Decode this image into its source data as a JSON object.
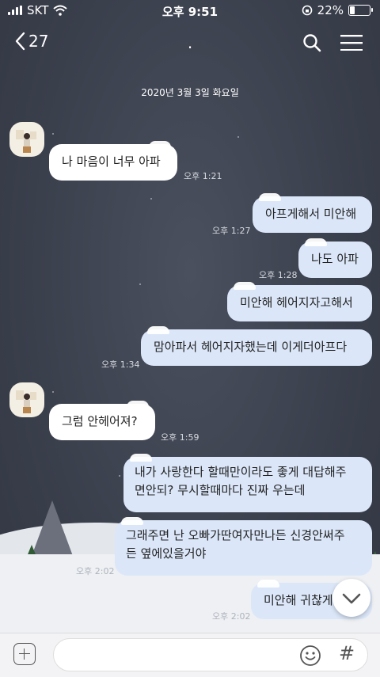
{
  "status": {
    "carrier": "SKT",
    "time": "오후 9:51",
    "battery": "22%"
  },
  "header": {
    "back_count": "27",
    "title": "."
  },
  "date_divider": "2020년 3월 3일 화요일",
  "messages": [
    {
      "side": "in",
      "text": "나 마음이 너무 아파",
      "time": "오후 1:21"
    },
    {
      "side": "out",
      "text": "아프게해서 미안해",
      "time": "오후 1:27"
    },
    {
      "side": "out",
      "text": "나도 아파",
      "time": "오후 1:28"
    },
    {
      "side": "out",
      "text": "미안해 헤어지자고해서",
      "time": ""
    },
    {
      "side": "out",
      "text": "맘아파서 헤어지자했는데 이게더아프다",
      "time": "오후 1:34"
    },
    {
      "side": "in",
      "text": "그럼 안헤어져?",
      "time": "오후 1:59"
    },
    {
      "side": "out",
      "text": "내가 사랑한다 할때만이라도 좋게 대답해주\n면안되? 무시할때마다 진짜 우는데",
      "time": ""
    },
    {
      "side": "out",
      "text": "그래주면 난 오빠가딴여자만나든 신경안써주\n든 옆에있을거야",
      "time": "오후 2:02"
    },
    {
      "side": "out",
      "text": "미안해 귀찮게",
      "time": "오후 2:02"
    }
  ],
  "input": {
    "placeholder": ""
  },
  "colors": {
    "background": "#3b4150",
    "bubble_in": "#ffffff",
    "bubble_out": "#dbe7f9"
  },
  "icons": [
    "back-chevron-icon",
    "search-icon",
    "menu-icon",
    "plus-icon",
    "emoji-icon",
    "hash-icon",
    "chevron-down-icon"
  ]
}
